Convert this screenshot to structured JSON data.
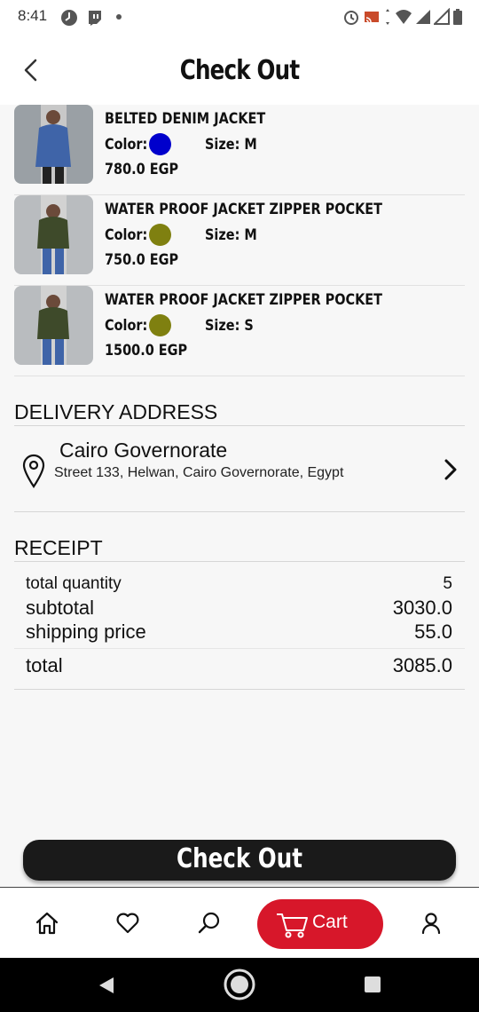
{
  "status_bar": {
    "time": "8:41"
  },
  "header": {
    "title": "Check Out"
  },
  "cart_items": [
    {
      "name": "BELTED DENIM JACKET",
      "color_label": "Color:",
      "color": "#0000cc",
      "size": "Size: M",
      "price": "780.0 EGP",
      "thumb_color": "#3f64a8"
    },
    {
      "name": "WATER PROOF JACKET ZIPPER POCKET",
      "color_label": "Color:",
      "color": "#7f8010",
      "size": "Size: M",
      "price": "750.0 EGP",
      "thumb_color": "#3e4a2a"
    },
    {
      "name": "WATER PROOF JACKET ZIPPER POCKET",
      "color_label": "Color:",
      "color": "#7f8010",
      "size": "Size: S",
      "price": "1500.0 EGP",
      "thumb_color": "#3e4a2a"
    }
  ],
  "delivery": {
    "title": "DELIVERY ADDRESS",
    "city": "Cairo Governorate",
    "address": "Street 133, Helwan, Cairo Governorate, Egypt"
  },
  "receipt": {
    "title": "RECEIPT",
    "rows": [
      {
        "label": "total quantity",
        "value": "5"
      },
      {
        "label": "subtotal",
        "value": "3030.0"
      },
      {
        "label": "shipping price",
        "value": "55.0"
      }
    ],
    "total_label": "total",
    "total_value": "3085.0"
  },
  "checkout_button": {
    "label": "Check Out"
  },
  "bottom_nav": {
    "items": [
      {
        "icon": "home-icon"
      },
      {
        "icon": "heart-icon"
      },
      {
        "icon": "search-icon"
      },
      {
        "icon": "cart-icon",
        "label": "Cart",
        "active": true
      },
      {
        "icon": "profile-icon"
      }
    ]
  },
  "colors": {
    "accent": "#d7172a",
    "dark": "#1a1a1a"
  }
}
